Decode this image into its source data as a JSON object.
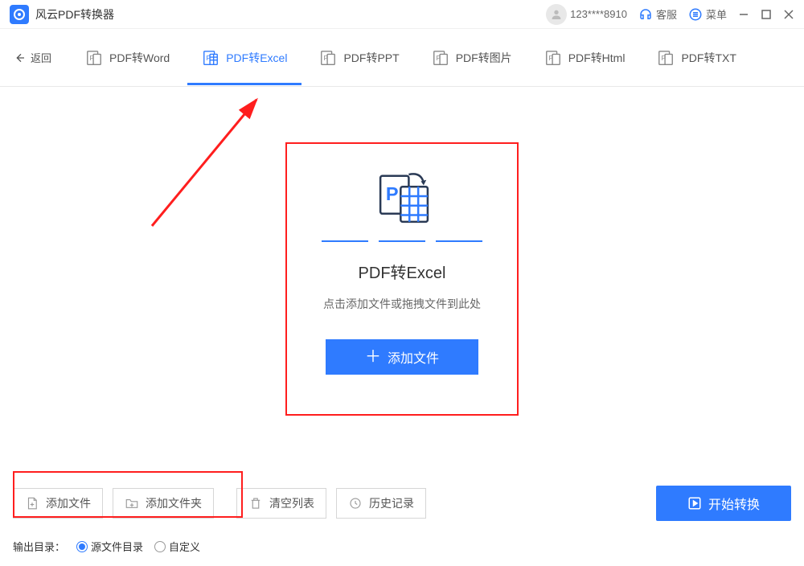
{
  "titlebar": {
    "appname": "风云PDF转换器",
    "user_id": "123****8910",
    "support_label": "客服",
    "menu_label": "菜单"
  },
  "tabs": {
    "back_label": "返回",
    "items": [
      {
        "label": "PDF转Word"
      },
      {
        "label": "PDF转Excel"
      },
      {
        "label": "PDF转PPT"
      },
      {
        "label": "PDF转图片"
      },
      {
        "label": "PDF转Html"
      },
      {
        "label": "PDF转TXT"
      }
    ]
  },
  "dropzone": {
    "title": "PDF转Excel",
    "subtitle": "点击添加文件或拖拽文件到此处",
    "add_button": "添加文件"
  },
  "footer": {
    "add_file": "添加文件",
    "add_folder": "添加文件夹",
    "clear_list": "清空列表",
    "history": "历史记录",
    "convert": "开始转换",
    "output_label": "输出目录：",
    "radio_source": "源文件目录",
    "radio_custom": "自定义"
  }
}
